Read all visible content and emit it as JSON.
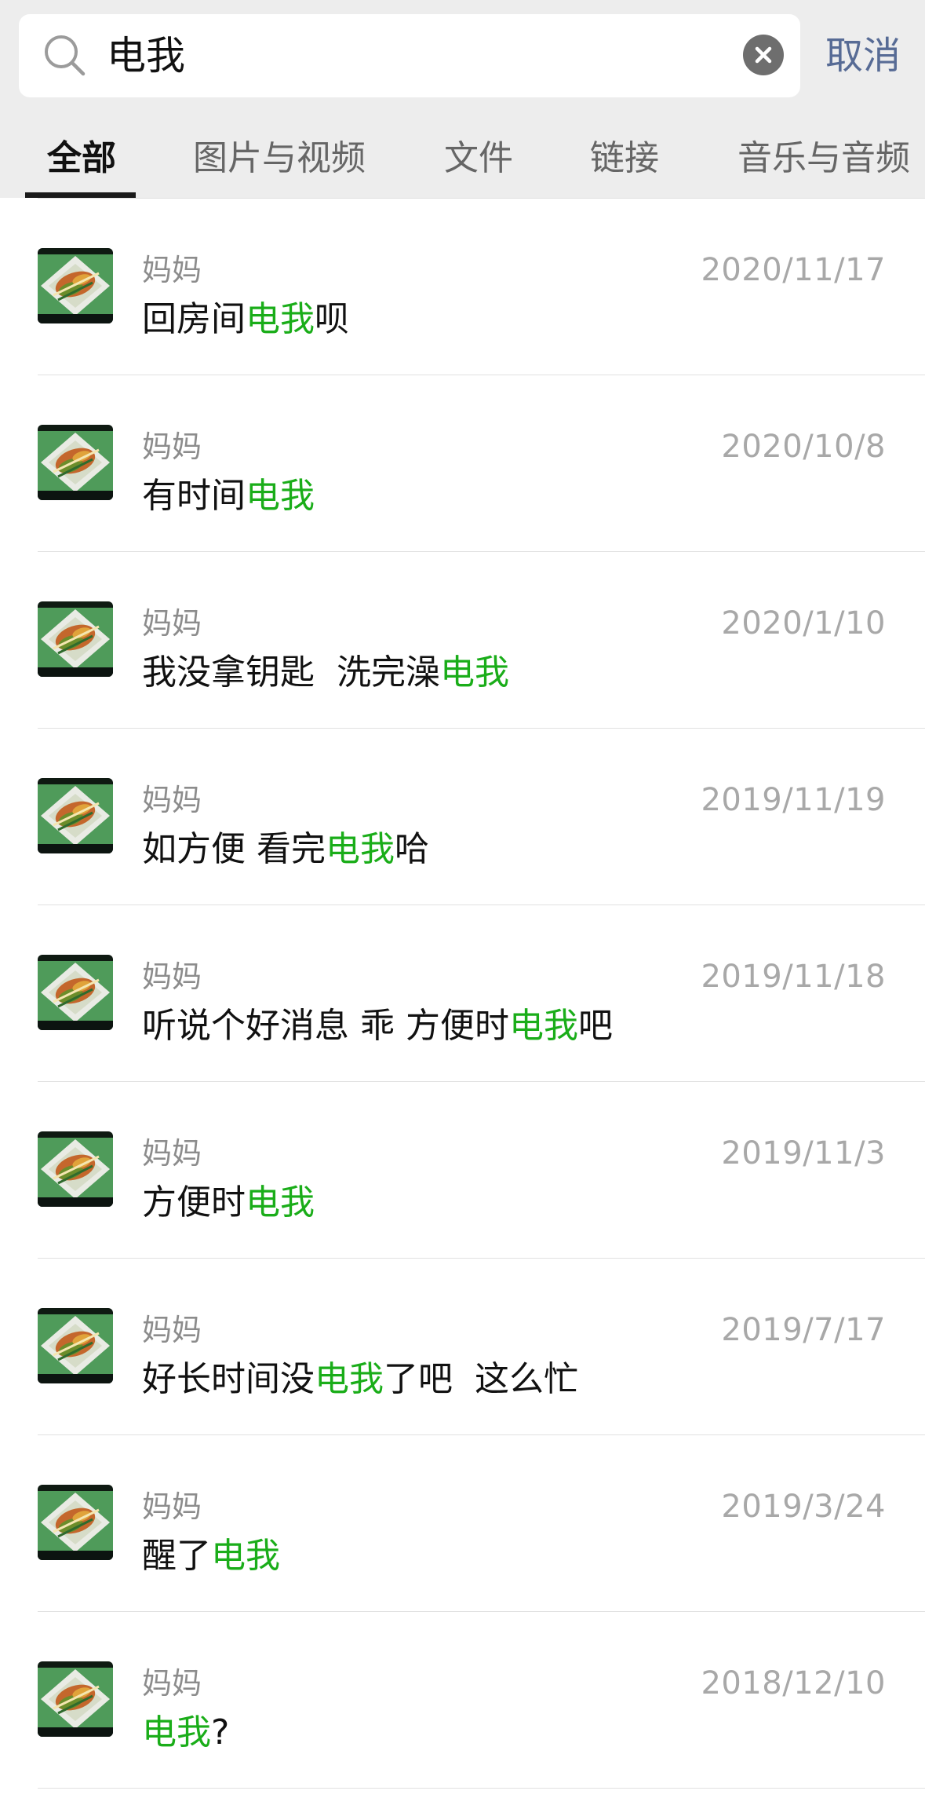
{
  "search": {
    "query": "电我",
    "cancel_label": "取消"
  },
  "tabs": [
    {
      "label": "全部",
      "active": true
    },
    {
      "label": "图片与视频",
      "active": false
    },
    {
      "label": "链接",
      "active": false
    },
    {
      "label": "文件",
      "active": false
    },
    {
      "label": "音乐与音频",
      "active": false
    }
  ],
  "highlight_color": "#1aad19",
  "results": [
    {
      "sender": "妈妈",
      "date": "2020/11/17",
      "before": "回房间",
      "match": "电我",
      "after": "呗"
    },
    {
      "sender": "妈妈",
      "date": "2020/10/8",
      "before": "有时间",
      "match": "电我",
      "after": ""
    },
    {
      "sender": "妈妈",
      "date": "2020/1/10",
      "before": "我没拿钥匙  洗完澡",
      "match": "电我",
      "after": ""
    },
    {
      "sender": "妈妈",
      "date": "2019/11/19",
      "before": "如方便 看完",
      "match": "电我",
      "after": "哈"
    },
    {
      "sender": "妈妈",
      "date": "2019/11/18",
      "before": "听说个好消息 乖 方便时",
      "match": "电我",
      "after": "吧"
    },
    {
      "sender": "妈妈",
      "date": "2019/11/3",
      "before": "方便时",
      "match": "电我",
      "after": ""
    },
    {
      "sender": "妈妈",
      "date": "2019/7/17",
      "before": "好长时间没",
      "match": "电我",
      "after": "了吧  这么忙"
    },
    {
      "sender": "妈妈",
      "date": "2019/3/24",
      "before": "醒了",
      "match": "电我",
      "after": ""
    },
    {
      "sender": "妈妈",
      "date": "2018/12/10",
      "before": "",
      "match": "电我",
      "after": "?"
    }
  ]
}
